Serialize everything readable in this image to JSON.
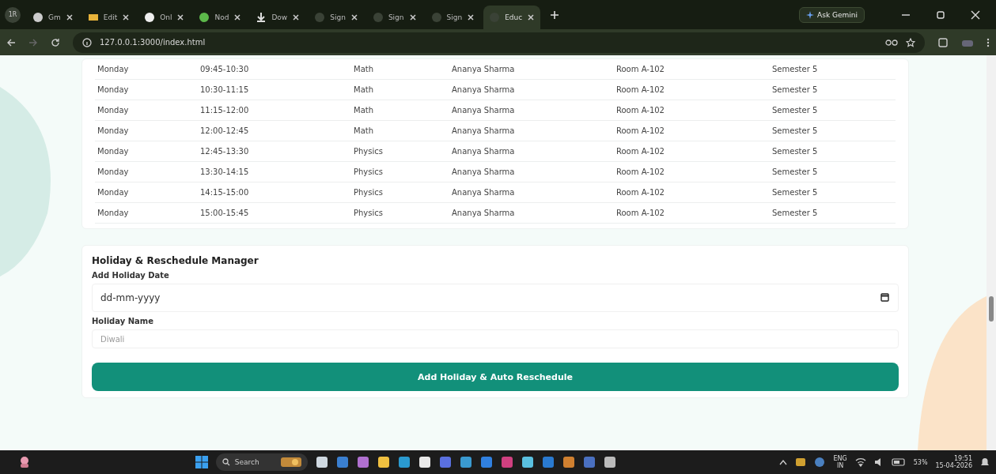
{
  "browser": {
    "profile": "1R",
    "tabs": [
      {
        "label": "Gm",
        "selected": false
      },
      {
        "label": "Edit",
        "selected": false
      },
      {
        "label": "Onl",
        "selected": false
      },
      {
        "label": "Nod",
        "selected": false
      },
      {
        "label": "Dow",
        "selected": false
      },
      {
        "label": "Sign",
        "selected": false
      },
      {
        "label": "Sign",
        "selected": false
      },
      {
        "label": "Sign",
        "selected": false
      },
      {
        "label": "Educ",
        "selected": true
      }
    ],
    "gemini_button": "Ask Gemini",
    "url": "127.0.0.1:3000/index.html"
  },
  "table": {
    "rows": [
      [
        "Monday",
        "09:45-10:30",
        "Math",
        "Ananya Sharma",
        "Room A-102",
        "Semester 5"
      ],
      [
        "Monday",
        "10:30-11:15",
        "Math",
        "Ananya Sharma",
        "Room A-102",
        "Semester 5"
      ],
      [
        "Monday",
        "11:15-12:00",
        "Math",
        "Ananya Sharma",
        "Room A-102",
        "Semester 5"
      ],
      [
        "Monday",
        "12:00-12:45",
        "Math",
        "Ananya Sharma",
        "Room A-102",
        "Semester 5"
      ],
      [
        "Monday",
        "12:45-13:30",
        "Physics",
        "Ananya Sharma",
        "Room A-102",
        "Semester 5"
      ],
      [
        "Monday",
        "13:30-14:15",
        "Physics",
        "Ananya Sharma",
        "Room A-102",
        "Semester 5"
      ],
      [
        "Monday",
        "14:15-15:00",
        "Physics",
        "Ananya Sharma",
        "Room A-102",
        "Semester 5"
      ],
      [
        "Monday",
        "15:00-15:45",
        "Physics",
        "Ananya Sharma",
        "Room A-102",
        "Semester 5"
      ]
    ]
  },
  "holiday": {
    "title": "Holiday & Reschedule Manager",
    "date_label": "Add Holiday Date",
    "date_placeholder": "dd-mm-yyyy",
    "name_label": "Holiday Name",
    "name_placeholder": "Diwali",
    "button": "Add Holiday & Auto Reschedule"
  },
  "taskbar": {
    "search": "Search",
    "language": "ENG",
    "region": "IN",
    "battery": "53%",
    "time": "19:51",
    "date": "15-04-2026"
  }
}
